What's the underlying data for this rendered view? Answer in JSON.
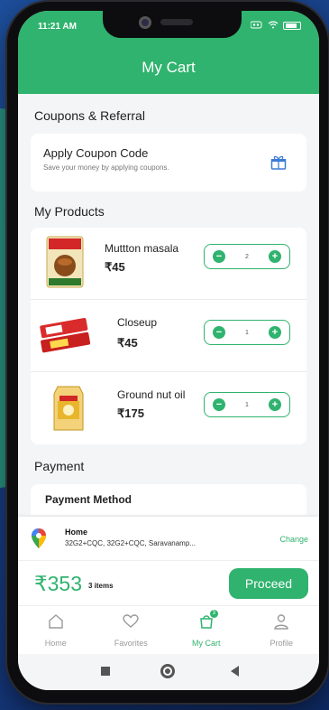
{
  "status_bar": {
    "time": "11:21 AM"
  },
  "header": {
    "title": "My Cart"
  },
  "coupons": {
    "section_title": "Coupons & Referral",
    "card_title": "Apply Coupon Code",
    "card_subtitle": "Save your money by applying coupons.",
    "icon": "gift-icon"
  },
  "products": {
    "section_title": "My Products",
    "items": [
      {
        "name": "Muttton masala",
        "price": "₹45",
        "qty": "2"
      },
      {
        "name": "Closeup",
        "price": "₹45",
        "qty": "1"
      },
      {
        "name": "Ground nut oil",
        "price": "₹175",
        "qty": "1"
      }
    ]
  },
  "payment": {
    "section_title": "Payment",
    "method_label": "Payment Method"
  },
  "address": {
    "label": "Home",
    "text": "32G2+CQC, 32G2+CQC, Saravanamp...",
    "change": "Change"
  },
  "checkout": {
    "total": "₹353",
    "items": "3 items",
    "proceed": "Proceed"
  },
  "bottom_nav": [
    {
      "label": "Home",
      "icon": "home-icon"
    },
    {
      "label": "Favorites",
      "icon": "heart-icon"
    },
    {
      "label": "My Cart",
      "icon": "cart-icon",
      "badge": "3"
    },
    {
      "label": "Profile",
      "icon": "user-icon"
    }
  ],
  "colors": {
    "accent": "#2fb36e",
    "background": "#f4f5f6"
  }
}
